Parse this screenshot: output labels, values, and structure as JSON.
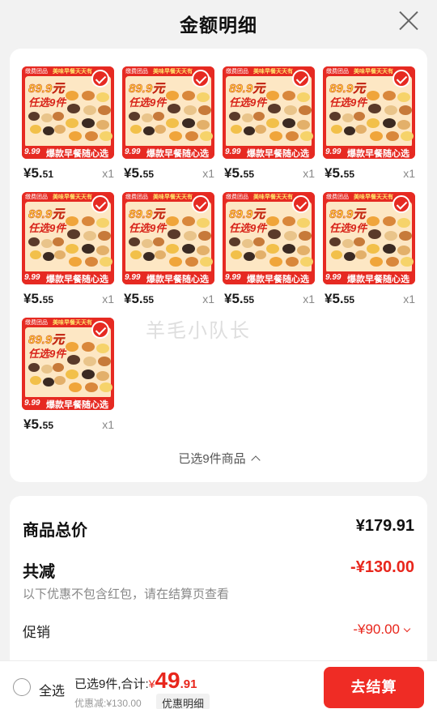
{
  "header": {
    "title": "金额明细"
  },
  "product": {
    "brand": "缴费团品",
    "slogan": "美味早餐天天有",
    "promo_price": "89.9元",
    "pick": "任选9件",
    "bottom_price": "9.99",
    "bottom_text": "爆款早餐随心选"
  },
  "items": [
    {
      "price_int": "¥5.",
      "price_dec": "51",
      "qty": "x1"
    },
    {
      "price_int": "¥5.",
      "price_dec": "55",
      "qty": "x1"
    },
    {
      "price_int": "¥5.",
      "price_dec": "55",
      "qty": "x1"
    },
    {
      "price_int": "¥5.",
      "price_dec": "55",
      "qty": "x1"
    },
    {
      "price_int": "¥5.",
      "price_dec": "55",
      "qty": "x1"
    },
    {
      "price_int": "¥5.",
      "price_dec": "55",
      "qty": "x1"
    },
    {
      "price_int": "¥5.",
      "price_dec": "55",
      "qty": "x1"
    },
    {
      "price_int": "¥5.",
      "price_dec": "55",
      "qty": "x1"
    },
    {
      "price_int": "¥5.",
      "price_dec": "55",
      "qty": "x1"
    }
  ],
  "selected_summary": "已选9件商品",
  "watermark": "羊毛小队长",
  "breakdown": {
    "total_label": "商品总价",
    "total_value": "¥179.91",
    "minus_label": "共减",
    "minus_value": "-¥130.00",
    "note": "以下优惠不包含红包，请在结算页查看",
    "promo_label": "促销",
    "promo_value": "-¥90.00"
  },
  "footer": {
    "select_all": "全选",
    "summary_prefix": "已选9件,合计:",
    "currency": "¥",
    "total_int": "49",
    "total_dec": ".91",
    "discount": "优惠减:¥130.00",
    "detail_button": "优惠明细",
    "checkout_button": "去结算"
  },
  "colors": {
    "accent": "#e8261c",
    "checkout_bg": "#ef2c25",
    "card_red": "#e62a22"
  }
}
